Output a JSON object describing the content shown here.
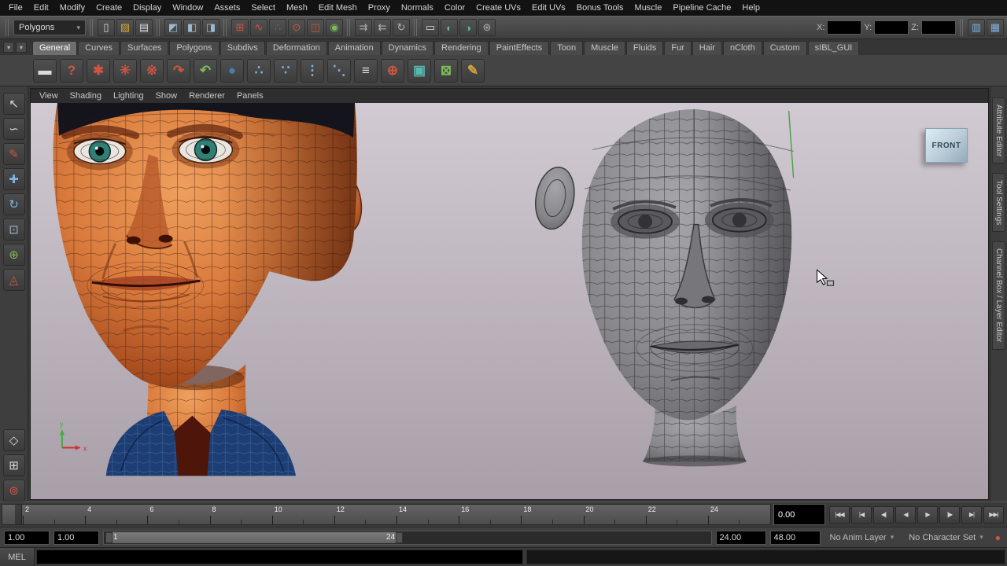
{
  "colors": {
    "viewport_bg_top": "#d2cad2",
    "viewport_bg_bottom": "#a89fa9",
    "skin_tone": "#d97a3c",
    "wireframe_gray": "#86868a",
    "collar_blue": "#1c3e74",
    "eye_teal": "#2f7f75",
    "accent_red": "#cf5540",
    "accent_blue": "#7fb2dd",
    "accent_green": "#7dba58",
    "ui_dark": "#3e3e3e"
  },
  "menu_bar": {
    "items": [
      "File",
      "Edit",
      "Modify",
      "Create",
      "Display",
      "Window",
      "Assets",
      "Select",
      "Mesh",
      "Edit Mesh",
      "Proxy",
      "Normals",
      "Color",
      "Create UVs",
      "Edit UVs",
      "Bonus Tools",
      "Muscle",
      "Pipeline Cache",
      "Help"
    ]
  },
  "status_line": {
    "mode_selector": {
      "value": "Polygons",
      "caret": "▾"
    },
    "icons": {
      "new_scene": "▯",
      "open_scene": "▨",
      "save_scene": "▤",
      "select_hierarchy": "◩",
      "select_object": "◧",
      "select_component": "◨",
      "snap_grid": "⊞",
      "snap_curve": "∿",
      "snap_point": "∴",
      "snap_projected_center": "⊙",
      "snap_view_plane": "◫",
      "make_live": "◉",
      "input_connections": "⇉",
      "output_connections": "⇇",
      "construction_history": "↻",
      "open_render_view": "▭",
      "render_current_frame": "◐",
      "ipr_render": "◑",
      "render_settings": "⊛",
      "panel_layout_1": "▥",
      "panel_layout_2": "▦"
    },
    "coords": {
      "x_label": "X:",
      "y_label": "Y:",
      "z_label": "Z:",
      "x_value": "",
      "y_value": "",
      "z_value": ""
    }
  },
  "shelf": {
    "tabs": [
      {
        "label": "General",
        "active": true
      },
      {
        "label": "Curves"
      },
      {
        "label": "Surfaces"
      },
      {
        "label": "Polygons"
      },
      {
        "label": "Subdivs"
      },
      {
        "label": "Deformation"
      },
      {
        "label": "Animation"
      },
      {
        "label": "Dynamics"
      },
      {
        "label": "Rendering"
      },
      {
        "label": "PaintEffects"
      },
      {
        "label": "Toon"
      },
      {
        "label": "Muscle"
      },
      {
        "label": "Fluids"
      },
      {
        "label": "Fur"
      },
      {
        "label": "Hair"
      },
      {
        "label": "nCloth"
      },
      {
        "label": "Custom"
      },
      {
        "label": "sIBL_GUI"
      }
    ],
    "menu_caret": "▾",
    "icons": {
      "slate": "▬",
      "help": "?",
      "emitter_a": "✱",
      "emitter_b": "✳",
      "emitter_c": "※",
      "redo_curve": "↷",
      "undo_curve": "↶",
      "sphere": "●",
      "joint_a": "∴",
      "joint_b": "∵",
      "ik_handle": "⋮",
      "node_graph": "⋱",
      "outliner": "≡",
      "magnet": "⊕",
      "container": "▣",
      "package": "⊠",
      "brush": "✎"
    }
  },
  "tool_box": {
    "icons": {
      "select": "↖",
      "lasso": "∽",
      "paint_select": "✎",
      "move": "✚",
      "rotate": "↻",
      "scale": "⊡",
      "universal": "⊕",
      "soft_mod": "◬",
      "history_diamond": "◇",
      "grid": "⊞",
      "paint_sphere": "⊚"
    }
  },
  "viewport": {
    "menu": [
      "View",
      "Shading",
      "Lighting",
      "Show",
      "Renderer",
      "Panels"
    ],
    "camera_label": "FRONT",
    "axis_x_label": "x",
    "axis_y_label": "y"
  },
  "right_panel_tabs": [
    "Attribute Editor",
    "Tool Settings",
    "Channel Box / Layer Editor"
  ],
  "timeline": {
    "frame_numbers": [
      "2",
      "4",
      "6",
      "8",
      "10",
      "12",
      "14",
      "16",
      "18",
      "20",
      "22",
      "24"
    ],
    "current_time": "0.00",
    "playback": [
      {
        "name": "go-to-start",
        "glyph": "|◀◀"
      },
      {
        "name": "step-back-frame",
        "glyph": "|◀"
      },
      {
        "name": "step-back-key",
        "glyph": "◀|"
      },
      {
        "name": "play-backwards",
        "glyph": "◀"
      },
      {
        "name": "play-forwards",
        "glyph": "▶"
      },
      {
        "name": "step-forward-key",
        "glyph": "|▶"
      },
      {
        "name": "step-forward-frame",
        "glyph": "▶|"
      },
      {
        "name": "go-to-end",
        "glyph": "▶▶|"
      }
    ]
  },
  "range_slider": {
    "animation_start": "1.00",
    "playback_start": "1.00",
    "range_start_handle": "1",
    "range_end_handle": "24",
    "playback_end": "24.00",
    "animation_end": "48.00",
    "anim_layer": "No Anim Layer",
    "character_set": "No Character Set",
    "caret": "▾",
    "autokey_glyph": "●"
  },
  "command_line": {
    "label": "MEL",
    "input_value": ""
  }
}
